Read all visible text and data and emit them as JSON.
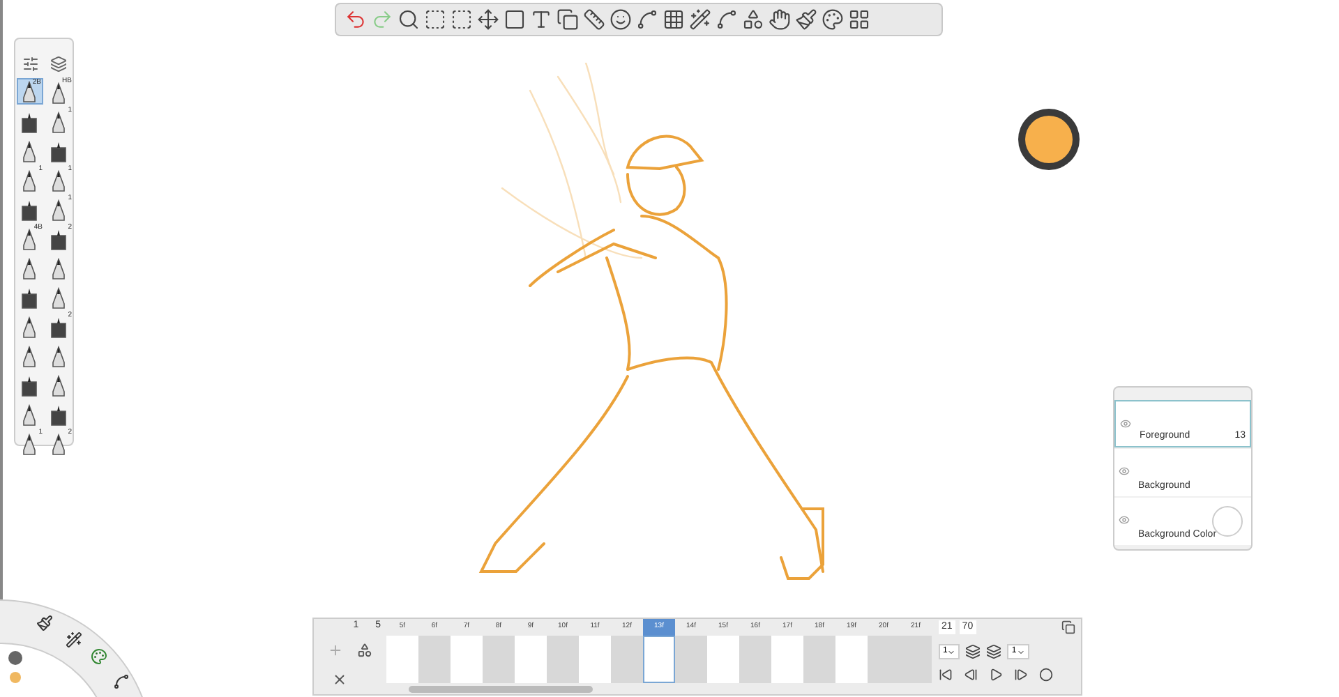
{
  "brush_palette": {
    "brushes": [
      {
        "badge": "2B",
        "selected": true
      },
      {
        "badge": "HB",
        "selected": false
      },
      {
        "selected": false
      },
      {
        "badge": "1",
        "selected": false
      },
      {
        "selected": false
      },
      {
        "selected": false
      },
      {
        "badge": "1",
        "selected": false
      },
      {
        "badge": "1",
        "selected": false
      },
      {
        "selected": false
      },
      {
        "badge": "1",
        "selected": false
      },
      {
        "badge": "4B",
        "selected": false
      },
      {
        "badge": "2",
        "selected": false
      },
      {
        "selected": false
      },
      {
        "selected": false
      },
      {
        "selected": false
      },
      {
        "selected": false
      },
      {
        "selected": false
      },
      {
        "badge": "2",
        "selected": false
      },
      {
        "selected": false
      },
      {
        "selected": false
      },
      {
        "selected": false
      },
      {
        "selected": false
      },
      {
        "selected": false
      },
      {
        "selected": false
      },
      {
        "badge": "1",
        "selected": false
      },
      {
        "badge": "2",
        "selected": false
      }
    ]
  },
  "color_puck": {
    "color": "#f7b04c"
  },
  "layers": [
    {
      "name": "Foreground",
      "count": "13",
      "selected": true
    },
    {
      "name": "Background",
      "selected": false
    },
    {
      "name": "Background Color",
      "selected": false
    }
  ],
  "timeline": {
    "start": "1",
    "start_frame": "5",
    "end_frame": "21",
    "total": "70",
    "frames": [
      {
        "label": "5f",
        "shaded": false,
        "selected": false
      },
      {
        "label": "6f",
        "shaded": true,
        "selected": false
      },
      {
        "label": "7f",
        "shaded": false,
        "selected": false
      },
      {
        "label": "8f",
        "shaded": true,
        "selected": false
      },
      {
        "label": "9f",
        "shaded": false,
        "selected": false
      },
      {
        "label": "10f",
        "shaded": true,
        "selected": false
      },
      {
        "label": "11f",
        "shaded": false,
        "selected": false
      },
      {
        "label": "12f",
        "shaded": true,
        "selected": false
      },
      {
        "label": "13f",
        "shaded": false,
        "selected": true
      },
      {
        "label": "14f",
        "shaded": true,
        "selected": false
      },
      {
        "label": "15f",
        "shaded": false,
        "selected": false
      },
      {
        "label": "16f",
        "shaded": true,
        "selected": false
      },
      {
        "label": "17f",
        "shaded": false,
        "selected": false
      },
      {
        "label": "18f",
        "shaded": true,
        "selected": false
      },
      {
        "label": "19f",
        "shaded": false,
        "selected": false
      },
      {
        "label": "20f",
        "shaded": true,
        "selected": false
      },
      {
        "label": "21f",
        "shaded": true,
        "selected": false
      }
    ],
    "before_count": "1",
    "after_count": "1"
  }
}
